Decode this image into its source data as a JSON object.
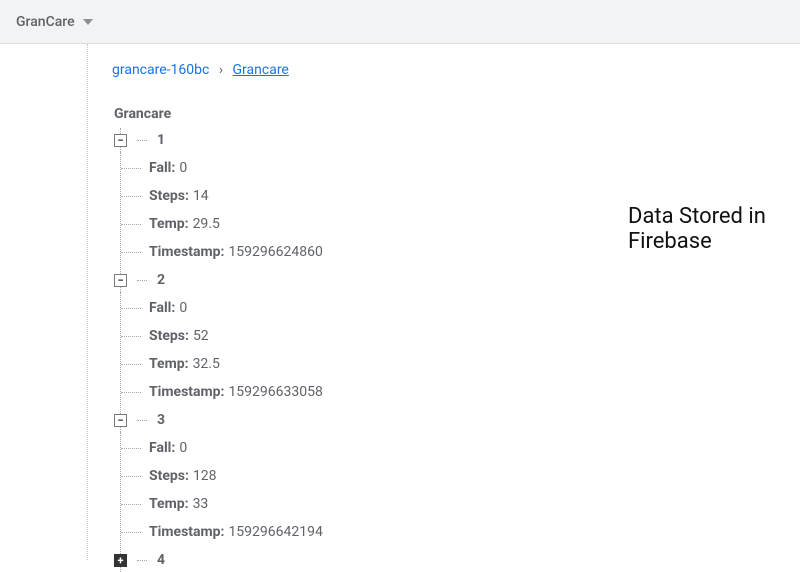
{
  "topbar": {
    "project_name": "GranCare"
  },
  "breadcrumb": {
    "root": "grancare-160bc",
    "current": "Grancare"
  },
  "tree": {
    "root_label": "Grancare",
    "nodes": [
      {
        "id": "1",
        "expanded": true,
        "fields": {
          "Fall": "0",
          "Steps": "14",
          "Temp": "29.5",
          "Timestamp": "159296624860"
        }
      },
      {
        "id": "2",
        "expanded": true,
        "fields": {
          "Fall": "0",
          "Steps": "52",
          "Temp": "32.5",
          "Timestamp": "159296633058"
        }
      },
      {
        "id": "3",
        "expanded": true,
        "fields": {
          "Fall": "0",
          "Steps": "128",
          "Temp": "33",
          "Timestamp": "159296642194"
        }
      },
      {
        "id": "4",
        "expanded": false
      }
    ]
  },
  "callout": {
    "line1": "Data Stored in",
    "line2": "Firebase"
  },
  "labels": {
    "toggle_minus": "−",
    "toggle_plus": "+"
  }
}
